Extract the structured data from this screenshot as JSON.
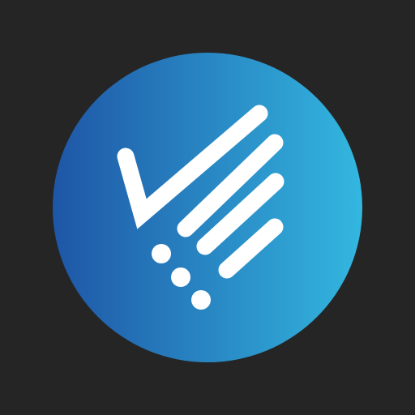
{
  "background_color": "#252525",
  "logo": {
    "shape": "circle",
    "gradient_start": "#1e56a6",
    "gradient_end": "#33b7e0",
    "mark_color": "#ffffff",
    "icon": "checkmark-with-speed-lines-and-dots"
  }
}
